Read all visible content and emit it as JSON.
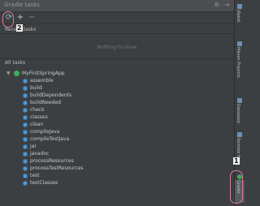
{
  "window": {
    "title": "Gradle tasks",
    "title_actions": "⚙ ⇥"
  },
  "toolbar": {
    "refresh_icon": "refresh-icon",
    "add_label": "+",
    "remove_label": "−"
  },
  "recent": {
    "label": "Recent tasks",
    "empty": "Nothing to show"
  },
  "all": {
    "label": "All tasks"
  },
  "tree": {
    "root": "MyFirstSpringApp",
    "tasks": [
      "assemble",
      "build",
      "buildDependents",
      "buildNeeded",
      "check",
      "classes",
      "clean",
      "compileJava",
      "compileTestJava",
      "jar",
      "javadoc",
      "processResources",
      "processTestResources",
      "test",
      "testClasses"
    ]
  },
  "sidebar": {
    "tabs": [
      {
        "label": "JRebel"
      },
      {
        "label": "Maven Projects"
      },
      {
        "label": "Database"
      },
      {
        "label": "Remote Host"
      },
      {
        "label": "Gradle"
      }
    ]
  },
  "annotations": {
    "one": "1",
    "two": "2"
  },
  "colors": {
    "accent": "#d9779b",
    "gradle": "#3cae5b",
    "task": "#4f9bd8"
  }
}
